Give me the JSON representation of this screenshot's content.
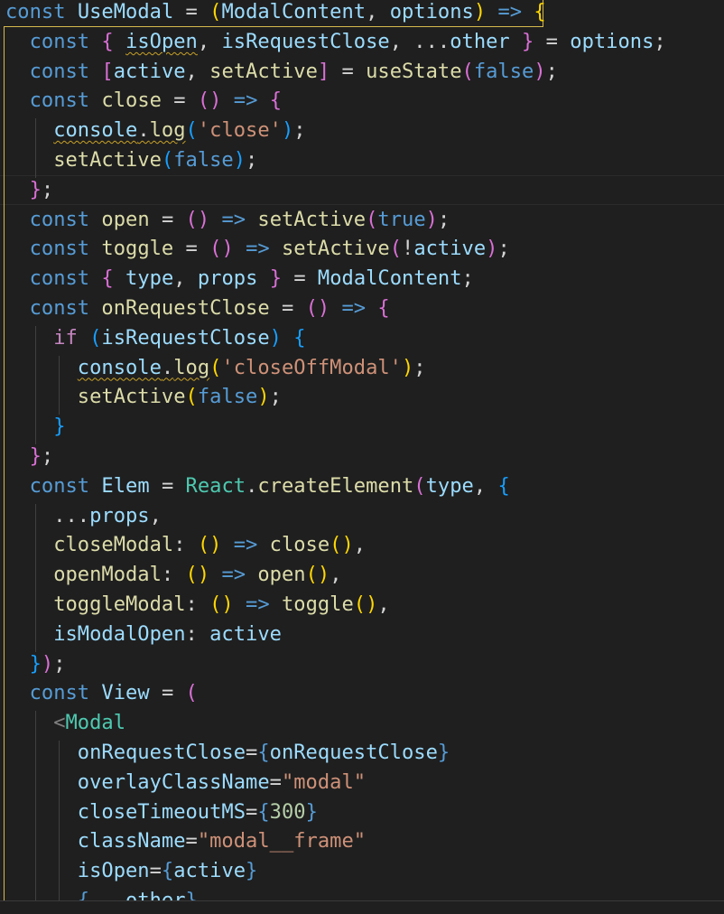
{
  "editor": {
    "language": "javascript",
    "theme_colors": {
      "keyword": "#569cd6",
      "variable": "#9cdcfe",
      "function": "#dcdcaa",
      "class": "#4ec9b0",
      "string": "#ce9178",
      "number": "#b5cea8",
      "control": "#c586c0",
      "bracket1": "#ffd700",
      "bracket2": "#da70d6",
      "bracket3": "#179fff",
      "default": "#d4d4d4",
      "warning_squiggle": "#c9a227"
    },
    "lines": [
      {
        "indent": 0,
        "tokens": [
          {
            "t": "const",
            "c": "keyword"
          },
          {
            "t": " "
          },
          {
            "t": "UseModal",
            "c": "variable"
          },
          {
            "t": " = "
          },
          {
            "t": "(",
            "c": "bracket1"
          },
          {
            "t": "ModalContent",
            "c": "variable"
          },
          {
            "t": ", "
          },
          {
            "t": "options",
            "c": "variable"
          },
          {
            "t": ")",
            "c": "bracket1"
          },
          {
            "t": " "
          },
          {
            "t": "=>",
            "c": "keyword"
          },
          {
            "t": " "
          },
          {
            "t": "{",
            "c": "bracket1"
          }
        ]
      },
      {
        "indent": 1,
        "tokens": [
          {
            "t": "const",
            "c": "keyword"
          },
          {
            "t": " "
          },
          {
            "t": "{",
            "c": "bracket2"
          },
          {
            "t": " "
          },
          {
            "t": "isOpen",
            "c": "variable",
            "squiggle": true
          },
          {
            "t": ", "
          },
          {
            "t": "isRequestClose",
            "c": "variable"
          },
          {
            "t": ", ..."
          },
          {
            "t": "other",
            "c": "variable"
          },
          {
            "t": " "
          },
          {
            "t": "}",
            "c": "bracket2"
          },
          {
            "t": " = "
          },
          {
            "t": "options",
            "c": "variable"
          },
          {
            "t": ";"
          }
        ]
      },
      {
        "indent": 1,
        "tokens": [
          {
            "t": "const",
            "c": "keyword"
          },
          {
            "t": " "
          },
          {
            "t": "[",
            "c": "bracket2"
          },
          {
            "t": "active",
            "c": "variable"
          },
          {
            "t": ", "
          },
          {
            "t": "setActive",
            "c": "function"
          },
          {
            "t": "]",
            "c": "bracket2"
          },
          {
            "t": " = "
          },
          {
            "t": "useState",
            "c": "function"
          },
          {
            "t": "(",
            "c": "bracket2"
          },
          {
            "t": "false",
            "c": "keyword"
          },
          {
            "t": ")",
            "c": "bracket2"
          },
          {
            "t": ";"
          }
        ]
      },
      {
        "indent": 1,
        "tokens": [
          {
            "t": "const",
            "c": "keyword"
          },
          {
            "t": " "
          },
          {
            "t": "close",
            "c": "function"
          },
          {
            "t": " = "
          },
          {
            "t": "()",
            "c": "bracket2"
          },
          {
            "t": " "
          },
          {
            "t": "=>",
            "c": "keyword"
          },
          {
            "t": " "
          },
          {
            "t": "{",
            "c": "bracket2"
          }
        ]
      },
      {
        "indent": 2,
        "tokens": [
          {
            "t": "console",
            "c": "variable",
            "squiggle": true
          },
          {
            "t": ".",
            "squiggle": true
          },
          {
            "t": "log",
            "c": "function",
            "squiggle": true
          },
          {
            "t": "(",
            "c": "bracket3"
          },
          {
            "t": "'close'",
            "c": "string"
          },
          {
            "t": ")",
            "c": "bracket3"
          },
          {
            "t": ";"
          }
        ]
      },
      {
        "indent": 2,
        "tokens": [
          {
            "t": "setActive",
            "c": "function"
          },
          {
            "t": "(",
            "c": "bracket3"
          },
          {
            "t": "false",
            "c": "keyword"
          },
          {
            "t": ")",
            "c": "bracket3"
          },
          {
            "t": ";"
          }
        ]
      },
      {
        "indent": 1,
        "tokens": [
          {
            "t": "}",
            "c": "bracket2"
          },
          {
            "t": ";"
          }
        ]
      },
      {
        "indent": 1,
        "tokens": [
          {
            "t": "const",
            "c": "keyword"
          },
          {
            "t": " "
          },
          {
            "t": "open",
            "c": "function"
          },
          {
            "t": " = "
          },
          {
            "t": "()",
            "c": "bracket2"
          },
          {
            "t": " "
          },
          {
            "t": "=>",
            "c": "keyword"
          },
          {
            "t": " "
          },
          {
            "t": "setActive",
            "c": "function"
          },
          {
            "t": "(",
            "c": "bracket2"
          },
          {
            "t": "true",
            "c": "keyword"
          },
          {
            "t": ")",
            "c": "bracket2"
          },
          {
            "t": ";"
          }
        ]
      },
      {
        "indent": 1,
        "tokens": [
          {
            "t": "const",
            "c": "keyword"
          },
          {
            "t": " "
          },
          {
            "t": "toggle",
            "c": "function"
          },
          {
            "t": " = "
          },
          {
            "t": "()",
            "c": "bracket2"
          },
          {
            "t": " "
          },
          {
            "t": "=>",
            "c": "keyword"
          },
          {
            "t": " "
          },
          {
            "t": "setActive",
            "c": "function"
          },
          {
            "t": "(",
            "c": "bracket2"
          },
          {
            "t": "!"
          },
          {
            "t": "active",
            "c": "variable"
          },
          {
            "t": ")",
            "c": "bracket2"
          },
          {
            "t": ";"
          }
        ]
      },
      {
        "indent": 1,
        "tokens": [
          {
            "t": "const",
            "c": "keyword"
          },
          {
            "t": " "
          },
          {
            "t": "{",
            "c": "bracket2"
          },
          {
            "t": " "
          },
          {
            "t": "type",
            "c": "variable"
          },
          {
            "t": ", "
          },
          {
            "t": "props",
            "c": "variable"
          },
          {
            "t": " "
          },
          {
            "t": "}",
            "c": "bracket2"
          },
          {
            "t": " = "
          },
          {
            "t": "ModalContent",
            "c": "variable"
          },
          {
            "t": ";"
          }
        ]
      },
      {
        "indent": 1,
        "tokens": [
          {
            "t": "const",
            "c": "keyword"
          },
          {
            "t": " "
          },
          {
            "t": "onRequestClose",
            "c": "function"
          },
          {
            "t": " = "
          },
          {
            "t": "()",
            "c": "bracket2"
          },
          {
            "t": " "
          },
          {
            "t": "=>",
            "c": "keyword"
          },
          {
            "t": " "
          },
          {
            "t": "{",
            "c": "bracket2"
          }
        ]
      },
      {
        "indent": 2,
        "tokens": [
          {
            "t": "if",
            "c": "control"
          },
          {
            "t": " "
          },
          {
            "t": "(",
            "c": "bracket3"
          },
          {
            "t": "isRequestClose",
            "c": "variable"
          },
          {
            "t": ")",
            "c": "bracket3"
          },
          {
            "t": " "
          },
          {
            "t": "{",
            "c": "bracket3"
          }
        ]
      },
      {
        "indent": 3,
        "tokens": [
          {
            "t": "console",
            "c": "variable",
            "squiggle": true
          },
          {
            "t": ".",
            "squiggle": true
          },
          {
            "t": "log",
            "c": "function",
            "squiggle": true
          },
          {
            "t": "(",
            "c": "bracket1"
          },
          {
            "t": "'closeOffModal'",
            "c": "string"
          },
          {
            "t": ")",
            "c": "bracket1"
          },
          {
            "t": ";"
          }
        ]
      },
      {
        "indent": 3,
        "tokens": [
          {
            "t": "setActive",
            "c": "function"
          },
          {
            "t": "(",
            "c": "bracket1"
          },
          {
            "t": "false",
            "c": "keyword"
          },
          {
            "t": ")",
            "c": "bracket1"
          },
          {
            "t": ";"
          }
        ]
      },
      {
        "indent": 2,
        "tokens": [
          {
            "t": "}",
            "c": "bracket3"
          }
        ]
      },
      {
        "indent": 1,
        "tokens": [
          {
            "t": "}",
            "c": "bracket2"
          },
          {
            "t": ";"
          }
        ]
      },
      {
        "indent": 1,
        "tokens": [
          {
            "t": "const",
            "c": "keyword"
          },
          {
            "t": " "
          },
          {
            "t": "Elem",
            "c": "variable"
          },
          {
            "t": " = "
          },
          {
            "t": "React",
            "c": "class"
          },
          {
            "t": "."
          },
          {
            "t": "createElement",
            "c": "function"
          },
          {
            "t": "(",
            "c": "bracket2"
          },
          {
            "t": "type",
            "c": "variable"
          },
          {
            "t": ", "
          },
          {
            "t": "{",
            "c": "bracket3"
          }
        ]
      },
      {
        "indent": 2,
        "tokens": [
          {
            "t": "..."
          },
          {
            "t": "props",
            "c": "variable"
          },
          {
            "t": ","
          }
        ]
      },
      {
        "indent": 2,
        "tokens": [
          {
            "t": "closeModal",
            "c": "function"
          },
          {
            "t": ": "
          },
          {
            "t": "()",
            "c": "bracket1"
          },
          {
            "t": " "
          },
          {
            "t": "=>",
            "c": "keyword"
          },
          {
            "t": " "
          },
          {
            "t": "close",
            "c": "function"
          },
          {
            "t": "()",
            "c": "bracket1"
          },
          {
            "t": ","
          }
        ]
      },
      {
        "indent": 2,
        "tokens": [
          {
            "t": "openModal",
            "c": "function"
          },
          {
            "t": ": "
          },
          {
            "t": "()",
            "c": "bracket1"
          },
          {
            "t": " "
          },
          {
            "t": "=>",
            "c": "keyword"
          },
          {
            "t": " "
          },
          {
            "t": "open",
            "c": "function"
          },
          {
            "t": "()",
            "c": "bracket1"
          },
          {
            "t": ","
          }
        ]
      },
      {
        "indent": 2,
        "tokens": [
          {
            "t": "toggleModal",
            "c": "function"
          },
          {
            "t": ": "
          },
          {
            "t": "()",
            "c": "bracket1"
          },
          {
            "t": " "
          },
          {
            "t": "=>",
            "c": "keyword"
          },
          {
            "t": " "
          },
          {
            "t": "toggle",
            "c": "function"
          },
          {
            "t": "()",
            "c": "bracket1"
          },
          {
            "t": ","
          }
        ]
      },
      {
        "indent": 2,
        "tokens": [
          {
            "t": "isModalOpen",
            "c": "variable"
          },
          {
            "t": ": "
          },
          {
            "t": "active",
            "c": "variable"
          }
        ]
      },
      {
        "indent": 1,
        "tokens": [
          {
            "t": "}",
            "c": "bracket3"
          },
          {
            "t": ")",
            "c": "bracket2"
          },
          {
            "t": ";"
          }
        ]
      },
      {
        "indent": 1,
        "tokens": [
          {
            "t": "const",
            "c": "keyword"
          },
          {
            "t": " "
          },
          {
            "t": "View",
            "c": "variable"
          },
          {
            "t": " = "
          },
          {
            "t": "(",
            "c": "bracket2"
          }
        ]
      },
      {
        "indent": 2,
        "tokens": [
          {
            "t": "<",
            "c": "tagpunct"
          },
          {
            "t": "Modal",
            "c": "class"
          }
        ]
      },
      {
        "indent": 3,
        "tokens": [
          {
            "t": "onRequestClose",
            "c": "variable"
          },
          {
            "t": "="
          },
          {
            "t": "{",
            "c": "keyword"
          },
          {
            "t": "onRequestClose",
            "c": "variable"
          },
          {
            "t": "}",
            "c": "keyword"
          }
        ]
      },
      {
        "indent": 3,
        "tokens": [
          {
            "t": "overlayClassName",
            "c": "variable"
          },
          {
            "t": "="
          },
          {
            "t": "\"modal\"",
            "c": "string"
          }
        ]
      },
      {
        "indent": 3,
        "tokens": [
          {
            "t": "closeTimeoutMS",
            "c": "variable"
          },
          {
            "t": "="
          },
          {
            "t": "{",
            "c": "keyword"
          },
          {
            "t": "300",
            "c": "number"
          },
          {
            "t": "}",
            "c": "keyword"
          }
        ]
      },
      {
        "indent": 3,
        "tokens": [
          {
            "t": "className",
            "c": "variable"
          },
          {
            "t": "="
          },
          {
            "t": "\"modal__frame\"",
            "c": "string"
          }
        ]
      },
      {
        "indent": 3,
        "tokens": [
          {
            "t": "isOpen",
            "c": "variable"
          },
          {
            "t": "="
          },
          {
            "t": "{",
            "c": "keyword"
          },
          {
            "t": "active",
            "c": "variable"
          },
          {
            "t": "}",
            "c": "keyword"
          }
        ]
      },
      {
        "indent": 3,
        "tokens": [
          {
            "t": "{",
            "c": "keyword"
          },
          {
            "t": "..."
          },
          {
            "t": "other",
            "c": "variable"
          },
          {
            "t": "}",
            "c": "keyword"
          }
        ]
      }
    ]
  }
}
